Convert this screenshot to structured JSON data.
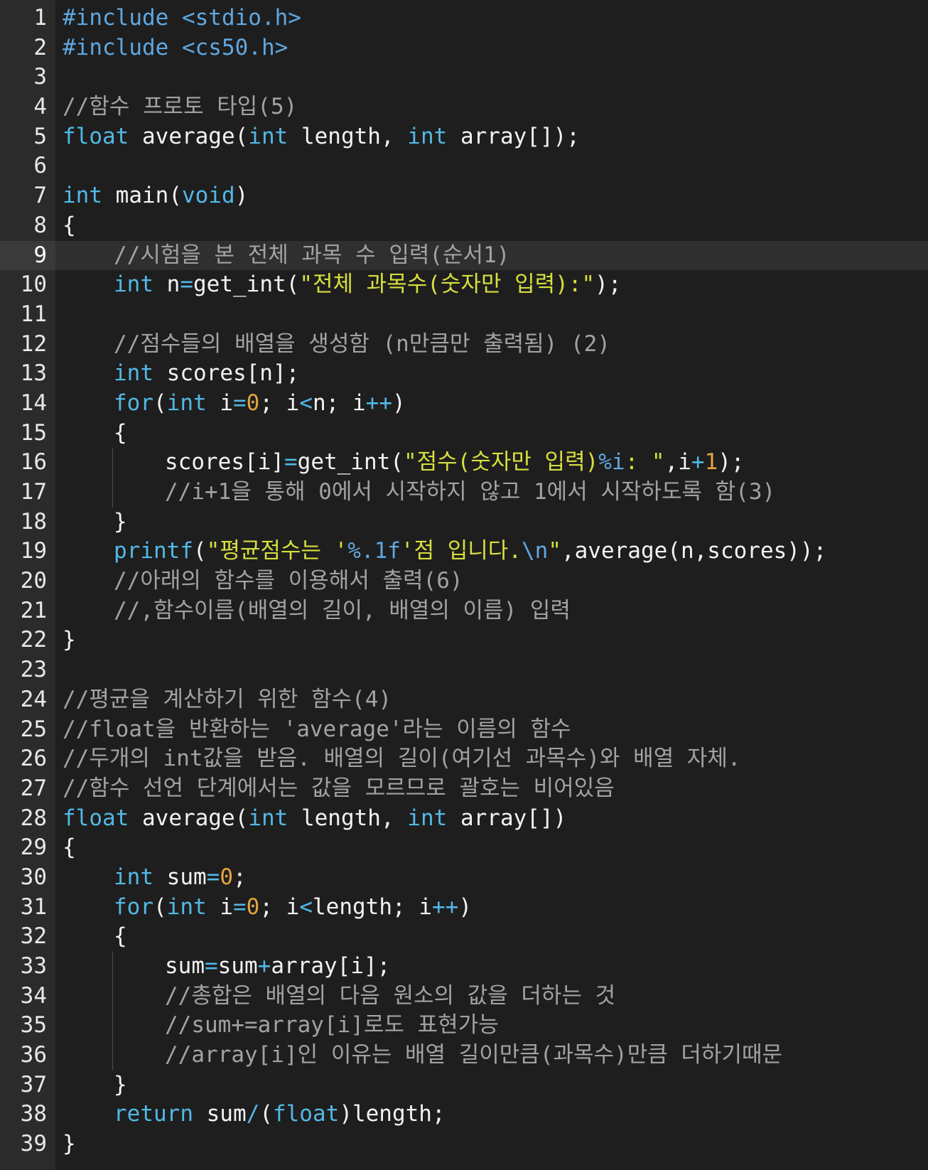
{
  "editor": {
    "theme": {
      "background": "#1e1e1e",
      "gutter": "#2b2b2b",
      "active_line": "#2f2f2f",
      "keyword": "#52b8e6",
      "string": "#d7df3e",
      "number": "#e6a33f",
      "comment": "#a2a2a2",
      "text": "#f2f2f2"
    },
    "active_line": 9,
    "lines": [
      {
        "n": "1",
        "indent": 0,
        "tokens": [
          [
            "dir",
            "#include "
          ],
          [
            "dir",
            "<stdio.h>"
          ]
        ]
      },
      {
        "n": "2",
        "indent": 0,
        "tokens": [
          [
            "dir",
            "#include "
          ],
          [
            "dir",
            "<cs50.h>"
          ]
        ]
      },
      {
        "n": "3",
        "indent": 0,
        "tokens": []
      },
      {
        "n": "4",
        "indent": 0,
        "tokens": [
          [
            "cmt",
            "//함수 프로토 타입(5)"
          ]
        ]
      },
      {
        "n": "5",
        "indent": 0,
        "tokens": [
          [
            "kw",
            "float"
          ],
          [
            "plain",
            " average("
          ],
          [
            "kw",
            "int"
          ],
          [
            "plain",
            " length, "
          ],
          [
            "kw",
            "int"
          ],
          [
            "plain",
            " array[]);"
          ]
        ]
      },
      {
        "n": "6",
        "indent": 0,
        "tokens": []
      },
      {
        "n": "7",
        "indent": 0,
        "tokens": [
          [
            "kw",
            "int"
          ],
          [
            "plain",
            " main("
          ],
          [
            "kw",
            "void"
          ],
          [
            "plain",
            ")"
          ]
        ]
      },
      {
        "n": "8",
        "indent": 0,
        "tokens": [
          [
            "plain",
            "{"
          ]
        ]
      },
      {
        "n": "9",
        "indent": 1,
        "tokens": [
          [
            "cmt",
            "//시험을 본 전체 과목 수 입력(순서1)"
          ]
        ]
      },
      {
        "n": "10",
        "indent": 1,
        "tokens": [
          [
            "kw",
            "int"
          ],
          [
            "plain",
            " n"
          ],
          [
            "op",
            "="
          ],
          [
            "plain",
            "get_int("
          ],
          [
            "str",
            "\"전체 과목수(숫자만 입력):\""
          ],
          [
            "plain",
            ");"
          ]
        ]
      },
      {
        "n": "11",
        "indent": 0,
        "tokens": []
      },
      {
        "n": "12",
        "indent": 1,
        "tokens": [
          [
            "cmt",
            "//점수들의 배열을 생성함 (n만큼만 출력됨) (2)"
          ]
        ]
      },
      {
        "n": "13",
        "indent": 1,
        "tokens": [
          [
            "kw",
            "int"
          ],
          [
            "plain",
            " scores[n];"
          ]
        ]
      },
      {
        "n": "14",
        "indent": 1,
        "tokens": [
          [
            "kw",
            "for"
          ],
          [
            "plain",
            "("
          ],
          [
            "kw",
            "int"
          ],
          [
            "plain",
            " i"
          ],
          [
            "op",
            "="
          ],
          [
            "num",
            "0"
          ],
          [
            "plain",
            "; i"
          ],
          [
            "op",
            "<"
          ],
          [
            "plain",
            "n; i"
          ],
          [
            "op",
            "++"
          ],
          [
            "plain",
            ")"
          ]
        ]
      },
      {
        "n": "15",
        "indent": 1,
        "tokens": [
          [
            "plain",
            "{"
          ]
        ]
      },
      {
        "n": "16",
        "indent": 2,
        "tokens": [
          [
            "plain",
            "scores[i]"
          ],
          [
            "op",
            "="
          ],
          [
            "plain",
            "get_int("
          ],
          [
            "str",
            "\"점수(숫자만 입력)"
          ],
          [
            "fmt",
            "%i"
          ],
          [
            "str",
            ": \""
          ],
          [
            "plain",
            ",i"
          ],
          [
            "op",
            "+"
          ],
          [
            "num",
            "1"
          ],
          [
            "plain",
            ");"
          ]
        ]
      },
      {
        "n": "17",
        "indent": 2,
        "tokens": [
          [
            "cmt",
            "//i+1을 통해 0에서 시작하지 않고 1에서 시작하도록 함(3)"
          ]
        ]
      },
      {
        "n": "18",
        "indent": 1,
        "tokens": [
          [
            "plain",
            "}"
          ]
        ]
      },
      {
        "n": "19",
        "indent": 1,
        "tokens": [
          [
            "kw",
            "printf"
          ],
          [
            "plain",
            "("
          ],
          [
            "str",
            "\"평균점수는 '"
          ],
          [
            "fmt",
            "%.1f"
          ],
          [
            "str",
            "'점 입니다."
          ],
          [
            "fmt",
            "\\n"
          ],
          [
            "str",
            "\""
          ],
          [
            "plain",
            ",average(n,scores));"
          ]
        ]
      },
      {
        "n": "20",
        "indent": 1,
        "tokens": [
          [
            "cmt",
            "//아래의 함수를 이용해서 출력(6)"
          ]
        ]
      },
      {
        "n": "21",
        "indent": 1,
        "tokens": [
          [
            "cmt",
            "//,함수이름(배열의 길이, 배열의 이름) 입력"
          ]
        ]
      },
      {
        "n": "22",
        "indent": 0,
        "tokens": [
          [
            "plain",
            "}"
          ]
        ]
      },
      {
        "n": "23",
        "indent": 0,
        "tokens": []
      },
      {
        "n": "24",
        "indent": 0,
        "tokens": [
          [
            "cmt",
            "//평균을 계산하기 위한 함수(4)"
          ]
        ]
      },
      {
        "n": "25",
        "indent": 0,
        "tokens": [
          [
            "cmt",
            "//float을 반환하는 'average'라는 이름의 함수"
          ]
        ]
      },
      {
        "n": "26",
        "indent": 0,
        "tokens": [
          [
            "cmt",
            "//두개의 int값을 받음. 배열의 길이(여기선 과목수)와 배열 자체."
          ]
        ]
      },
      {
        "n": "27",
        "indent": 0,
        "tokens": [
          [
            "cmt",
            "//함수 선언 단계에서는 값을 모르므로 괄호는 비어있음"
          ]
        ]
      },
      {
        "n": "28",
        "indent": 0,
        "tokens": [
          [
            "kw",
            "float"
          ],
          [
            "plain",
            " average("
          ],
          [
            "kw",
            "int"
          ],
          [
            "plain",
            " length, "
          ],
          [
            "kw",
            "int"
          ],
          [
            "plain",
            " array[])"
          ]
        ]
      },
      {
        "n": "29",
        "indent": 0,
        "tokens": [
          [
            "plain",
            "{"
          ]
        ]
      },
      {
        "n": "30",
        "indent": 1,
        "tokens": [
          [
            "kw",
            "int"
          ],
          [
            "plain",
            " sum"
          ],
          [
            "op",
            "="
          ],
          [
            "num",
            "0"
          ],
          [
            "plain",
            ";"
          ]
        ]
      },
      {
        "n": "31",
        "indent": 1,
        "tokens": [
          [
            "kw",
            "for"
          ],
          [
            "plain",
            "("
          ],
          [
            "kw",
            "int"
          ],
          [
            "plain",
            " i"
          ],
          [
            "op",
            "="
          ],
          [
            "num",
            "0"
          ],
          [
            "plain",
            "; i"
          ],
          [
            "op",
            "<"
          ],
          [
            "plain",
            "length; i"
          ],
          [
            "op",
            "++"
          ],
          [
            "plain",
            ")"
          ]
        ]
      },
      {
        "n": "32",
        "indent": 1,
        "tokens": [
          [
            "plain",
            "{"
          ]
        ]
      },
      {
        "n": "33",
        "indent": 2,
        "tokens": [
          [
            "plain",
            "sum"
          ],
          [
            "op",
            "="
          ],
          [
            "plain",
            "sum"
          ],
          [
            "op",
            "+"
          ],
          [
            "plain",
            "array[i];"
          ]
        ]
      },
      {
        "n": "34",
        "indent": 2,
        "tokens": [
          [
            "cmt",
            "//총합은 배열의 다음 원소의 값을 더하는 것"
          ]
        ]
      },
      {
        "n": "35",
        "indent": 2,
        "tokens": [
          [
            "cmt",
            "//sum+=array[i]로도 표현가능"
          ]
        ]
      },
      {
        "n": "36",
        "indent": 2,
        "tokens": [
          [
            "cmt",
            "//array[i]인 이유는 배열 길이만큼(과목수)만큼 더하기때문"
          ]
        ]
      },
      {
        "n": "37",
        "indent": 1,
        "tokens": [
          [
            "plain",
            "}"
          ]
        ]
      },
      {
        "n": "38",
        "indent": 1,
        "tokens": [
          [
            "kw",
            "return"
          ],
          [
            "plain",
            " sum"
          ],
          [
            "op",
            "/"
          ],
          [
            "plain",
            "("
          ],
          [
            "kw",
            "float"
          ],
          [
            "plain",
            ")length;"
          ]
        ]
      },
      {
        "n": "39",
        "indent": 0,
        "tokens": [
          [
            "plain",
            "}"
          ]
        ]
      }
    ]
  }
}
